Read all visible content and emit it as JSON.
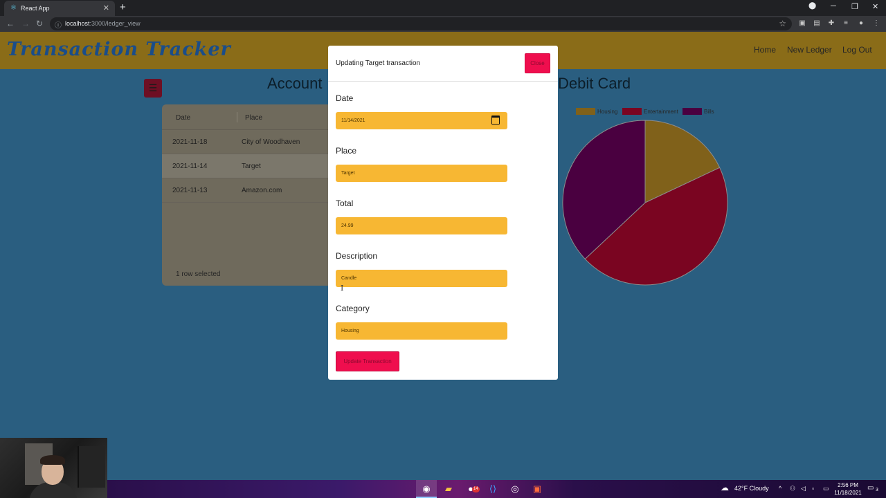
{
  "browser": {
    "tab_title": "React App",
    "new_tab_symbol": "+",
    "url_host": "localhost",
    "url_path": ":3000/ledger_view"
  },
  "app": {
    "brand": "Transaction Tracker",
    "nav": [
      "Home",
      "New Ledger",
      "Log Out"
    ],
    "headline_left": "Account",
    "headline_right": "Debit Card"
  },
  "grid": {
    "columns": [
      "Date",
      "Place"
    ],
    "rows": [
      {
        "date": "2021-11-18",
        "place": "City of Woodhaven",
        "selected": false
      },
      {
        "date": "2021-11-14",
        "place": "Target",
        "selected": true
      },
      {
        "date": "2021-11-13",
        "place": "Amazon.com",
        "selected": false
      }
    ],
    "footer": "1 row selected"
  },
  "chart_data": {
    "type": "pie",
    "legend": [
      "Housing",
      "Entertainment",
      "Bills"
    ],
    "colors": [
      "#80611a",
      "#7a0521",
      "#4a0040"
    ],
    "values": [
      18,
      45,
      37
    ]
  },
  "modal": {
    "title": "Updating Target transaction",
    "close_label": "Close",
    "fields": {
      "date": {
        "label": "Date",
        "value": "11/14/2021"
      },
      "place": {
        "label": "Place",
        "value": "Target"
      },
      "total": {
        "label": "Total",
        "value": "24.99"
      },
      "description": {
        "label": "Description",
        "value": "Candle"
      },
      "category": {
        "label": "Category",
        "value": "Housing"
      }
    },
    "submit_label": "Update Transaction"
  },
  "taskbar": {
    "weather": "42°F Cloudy",
    "time": "2:56 PM",
    "date": "11/18/2021",
    "notifications": "3",
    "file_explorer_badge": "14"
  }
}
